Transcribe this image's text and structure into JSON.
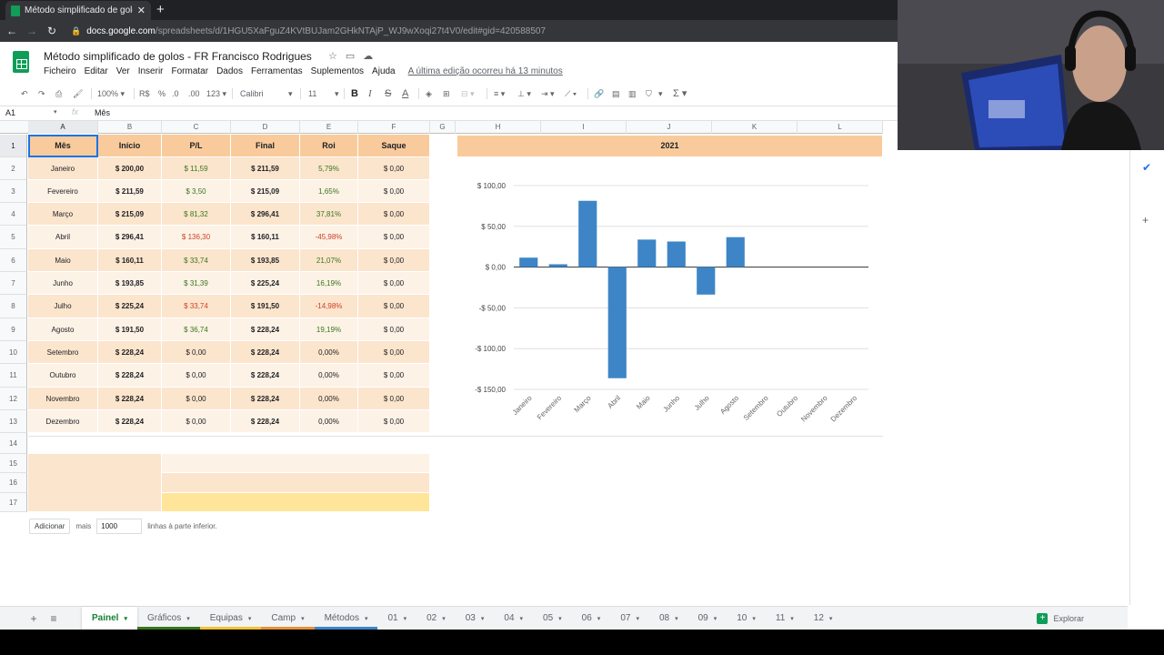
{
  "browser": {
    "tab_title": "Método simplificado de golos - F",
    "tab_close": "✕",
    "new_tab": "+",
    "url_domain": "docs.google.com",
    "url_path": "/spreadsheets/d/1HGU5XaFguZ4KVtBUJam2GHkNTAjP_WJ9wXoqi27t4V0/edit#gid=420588507"
  },
  "doc": {
    "title": "Método simplificado de golos - FR Francisco Rodrigues",
    "menu": [
      "Ficheiro",
      "Editar",
      "Ver",
      "Inserir",
      "Formatar",
      "Dados",
      "Ferramentas",
      "Suplementos",
      "Ajuda"
    ],
    "last_edit": "A última edição ocorreu há 13 minutos"
  },
  "toolbar": {
    "zoom": "100%",
    "currency": "R$",
    "percent": "%",
    "dec_less": ".0",
    "dec_more": ".00",
    "format_more": "123",
    "font": "Calibri",
    "font_size": "11"
  },
  "formula_bar": {
    "ref": "A1",
    "fx": "fx",
    "value": "Mês"
  },
  "columns": [
    "A",
    "B",
    "C",
    "D",
    "E",
    "F",
    "G",
    "H",
    "I",
    "J",
    "K",
    "L"
  ],
  "rows": [
    "1",
    "2",
    "3",
    "4",
    "5",
    "6",
    "7",
    "8",
    "9",
    "10",
    "11",
    "12",
    "13",
    "14",
    "15",
    "16",
    "17"
  ],
  "table": {
    "headers": [
      "Mês",
      "Início",
      "P/L",
      "Final",
      "Roi",
      "Saque"
    ],
    "rows": [
      [
        "Janeiro",
        "$ 200,00",
        "$ 11,59",
        "$ 211,59",
        "5,79%",
        "$ 0,00"
      ],
      [
        "Fevereiro",
        "$ 211,59",
        "$ 3,50",
        "$ 215,09",
        "1,65%",
        "$ 0,00"
      ],
      [
        "Março",
        "$ 215,09",
        "$ 81,32",
        "$ 296,41",
        "37,81%",
        "$ 0,00"
      ],
      [
        "Abril",
        "$ 296,41",
        "$ 136,30",
        "$ 160,11",
        "-45,98%",
        "$ 0,00"
      ],
      [
        "Maio",
        "$ 160,11",
        "$ 33,74",
        "$ 193,85",
        "21,07%",
        "$ 0,00"
      ],
      [
        "Junho",
        "$ 193,85",
        "$ 31,39",
        "$ 225,24",
        "16,19%",
        "$ 0,00"
      ],
      [
        "Julho",
        "$ 225,24",
        "$ 33,74",
        "$ 191,50",
        "-14,98%",
        "$ 0,00"
      ],
      [
        "Agosto",
        "$ 191,50",
        "$ 36,74",
        "$ 228,24",
        "19,19%",
        "$ 0,00"
      ],
      [
        "Setembro",
        "$ 228,24",
        "$ 0,00",
        "$ 228,24",
        "0,00%",
        "$ 0,00"
      ],
      [
        "Outubro",
        "$ 228,24",
        "$ 0,00",
        "$ 228,24",
        "0,00%",
        "$ 0,00"
      ],
      [
        "Novembro",
        "$ 228,24",
        "$ 0,00",
        "$ 228,24",
        "0,00%",
        "$ 0,00"
      ],
      [
        "Dezembro",
        "$ 228,24",
        "$ 0,00",
        "$ 228,24",
        "0,00%",
        "$ 0,00"
      ]
    ],
    "pl_sign": [
      "pos",
      "pos",
      "pos",
      "neg",
      "pos",
      "pos",
      "neg",
      "pos",
      "zero",
      "zero",
      "zero",
      "zero"
    ]
  },
  "chart_data": {
    "type": "bar",
    "title": "2021",
    "categories": [
      "Janeiro",
      "Fevereiro",
      "Março",
      "Abril",
      "Maio",
      "Junho",
      "Julho",
      "Agosto",
      "Setembro",
      "Outubro",
      "Novembro",
      "Dezembro"
    ],
    "values": [
      11.59,
      3.5,
      81.32,
      -136.3,
      33.74,
      31.39,
      -33.74,
      36.74,
      0,
      0,
      0,
      0
    ],
    "ylim": [
      -150,
      100
    ],
    "yticks": [
      "$ 100,00",
      "$ 50,00",
      "$ 0,00",
      "-$ 50,00",
      "-$ 100,00",
      "-$ 150,00"
    ],
    "ytick_values": [
      100,
      50,
      0,
      -50,
      -100,
      -150
    ],
    "bar_color": "#3d85c6",
    "grid": true
  },
  "add_rows": {
    "button": "Adicionar",
    "more": "mais",
    "count": "1000",
    "suffix": "linhas à parte inferior."
  },
  "sheet_tabs": [
    {
      "label": "Painel",
      "active": true,
      "color": ""
    },
    {
      "label": "Gráficos",
      "active": false,
      "color": "#38761d"
    },
    {
      "label": "Equipas",
      "active": false,
      "color": "#f1c232"
    },
    {
      "label": "Camp",
      "active": false,
      "color": "#e69138"
    },
    {
      "label": "Métodos",
      "active": false,
      "color": "#3d85c6"
    },
    {
      "label": "01",
      "active": false,
      "color": ""
    },
    {
      "label": "02",
      "active": false,
      "color": ""
    },
    {
      "label": "03",
      "active": false,
      "color": ""
    },
    {
      "label": "04",
      "active": false,
      "color": ""
    },
    {
      "label": "05",
      "active": false,
      "color": ""
    },
    {
      "label": "06",
      "active": false,
      "color": ""
    },
    {
      "label": "07",
      "active": false,
      "color": ""
    },
    {
      "label": "08",
      "active": false,
      "color": ""
    },
    {
      "label": "09",
      "active": false,
      "color": ""
    },
    {
      "label": "10",
      "active": false,
      "color": ""
    },
    {
      "label": "11",
      "active": false,
      "color": ""
    },
    {
      "label": "12",
      "active": false,
      "color": ""
    }
  ],
  "explore": "Explorar",
  "colors": {
    "header": "#f9cb9c",
    "row_a": "#fce5cd",
    "row_b": "#fdf2e6",
    "positive": "#38761d",
    "negative": "#cc4125",
    "yellow": "#ffe599"
  }
}
